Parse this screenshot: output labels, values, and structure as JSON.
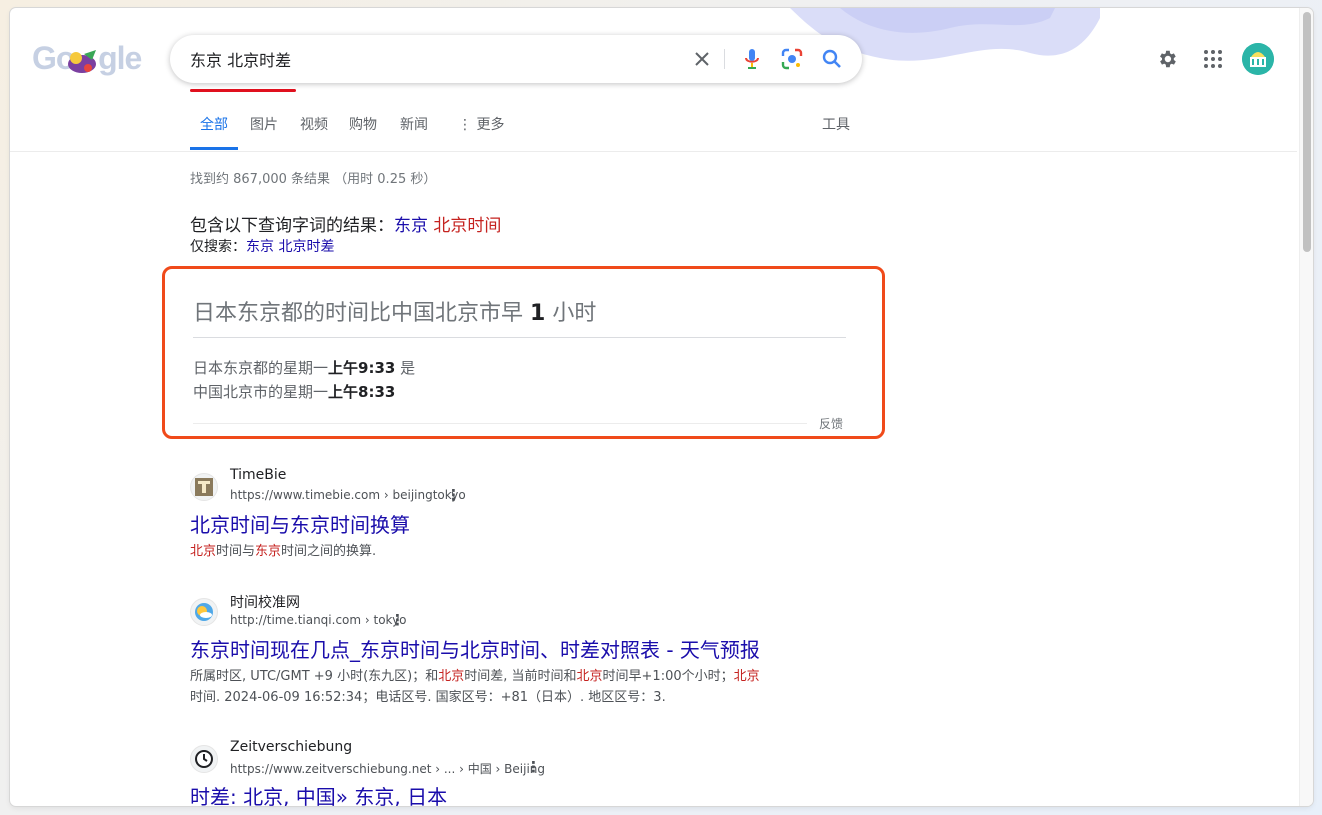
{
  "colors": {
    "accent": "#1a73e8",
    "link": "#1a0dab",
    "highlight_red": "#c5221f",
    "annotation_box": "#f04a1a"
  },
  "search": {
    "query": "东京 北京时差"
  },
  "tabs": [
    {
      "label": "全部",
      "active": true
    },
    {
      "label": "图片"
    },
    {
      "label": "视频"
    },
    {
      "label": "购物"
    },
    {
      "label": "新闻"
    },
    {
      "label": "更多"
    }
  ],
  "tools_label": "工具",
  "stats": "找到约 867,000 条结果 （用时 0.25 秒）",
  "correction": {
    "prefix": "包含以下查询字词的结果：",
    "q1": "东京",
    "q2": "北京时间",
    "only_prefix": "仅搜索：",
    "only_query": "东京 北京时差"
  },
  "answer": {
    "title_prefix": "日本东京都的时间比中国北京市早",
    "title_num": "1",
    "title_suffix": "小时",
    "line1_prefix": "日本东京都的星期一",
    "line1_time": "上午9:33",
    "line1_suffix": "是",
    "line2_prefix": "中国北京市的星期一",
    "line2_time": "上午8:33",
    "feedback": "反馈"
  },
  "results": [
    {
      "site": "TimeBie",
      "url": "https://www.timebie.com › beijingtokyo",
      "title": "北京时间与东京时间换算",
      "snippet_em1": "北京",
      "snippet_t1": "时间与",
      "snippet_em2": "东京",
      "snippet_t2": "时间之间的换算.",
      "icon": "timebie-icon"
    },
    {
      "site": "时间校准网",
      "url": "http://time.tianqi.com › tokyo",
      "title": "东京时间现在几点_东京时间与北京时间、时差对照表 - 天气预报",
      "snippet_t1": "所属时区, UTC/GMT +9 小时(东九区)；和",
      "snippet_em1": "北京",
      "snippet_t2": "时间差, 当前时间和",
      "snippet_em2": "北京",
      "snippet_t3": "时间早+1:00个小时；",
      "snippet_em3": "北京",
      "snippet_t4": "时间. 2024-06-09 16:52:34；电话区号. 国家区号：+81（日本）. 地区区号：3.",
      "icon": "tianqi-icon"
    },
    {
      "site": "Zeitverschiebung",
      "url": "https://www.zeitverschiebung.net › ... › 中国 › Beijing",
      "title": "时差: 北京, 中国» 东京, 日本",
      "icon": "clock-icon"
    }
  ]
}
